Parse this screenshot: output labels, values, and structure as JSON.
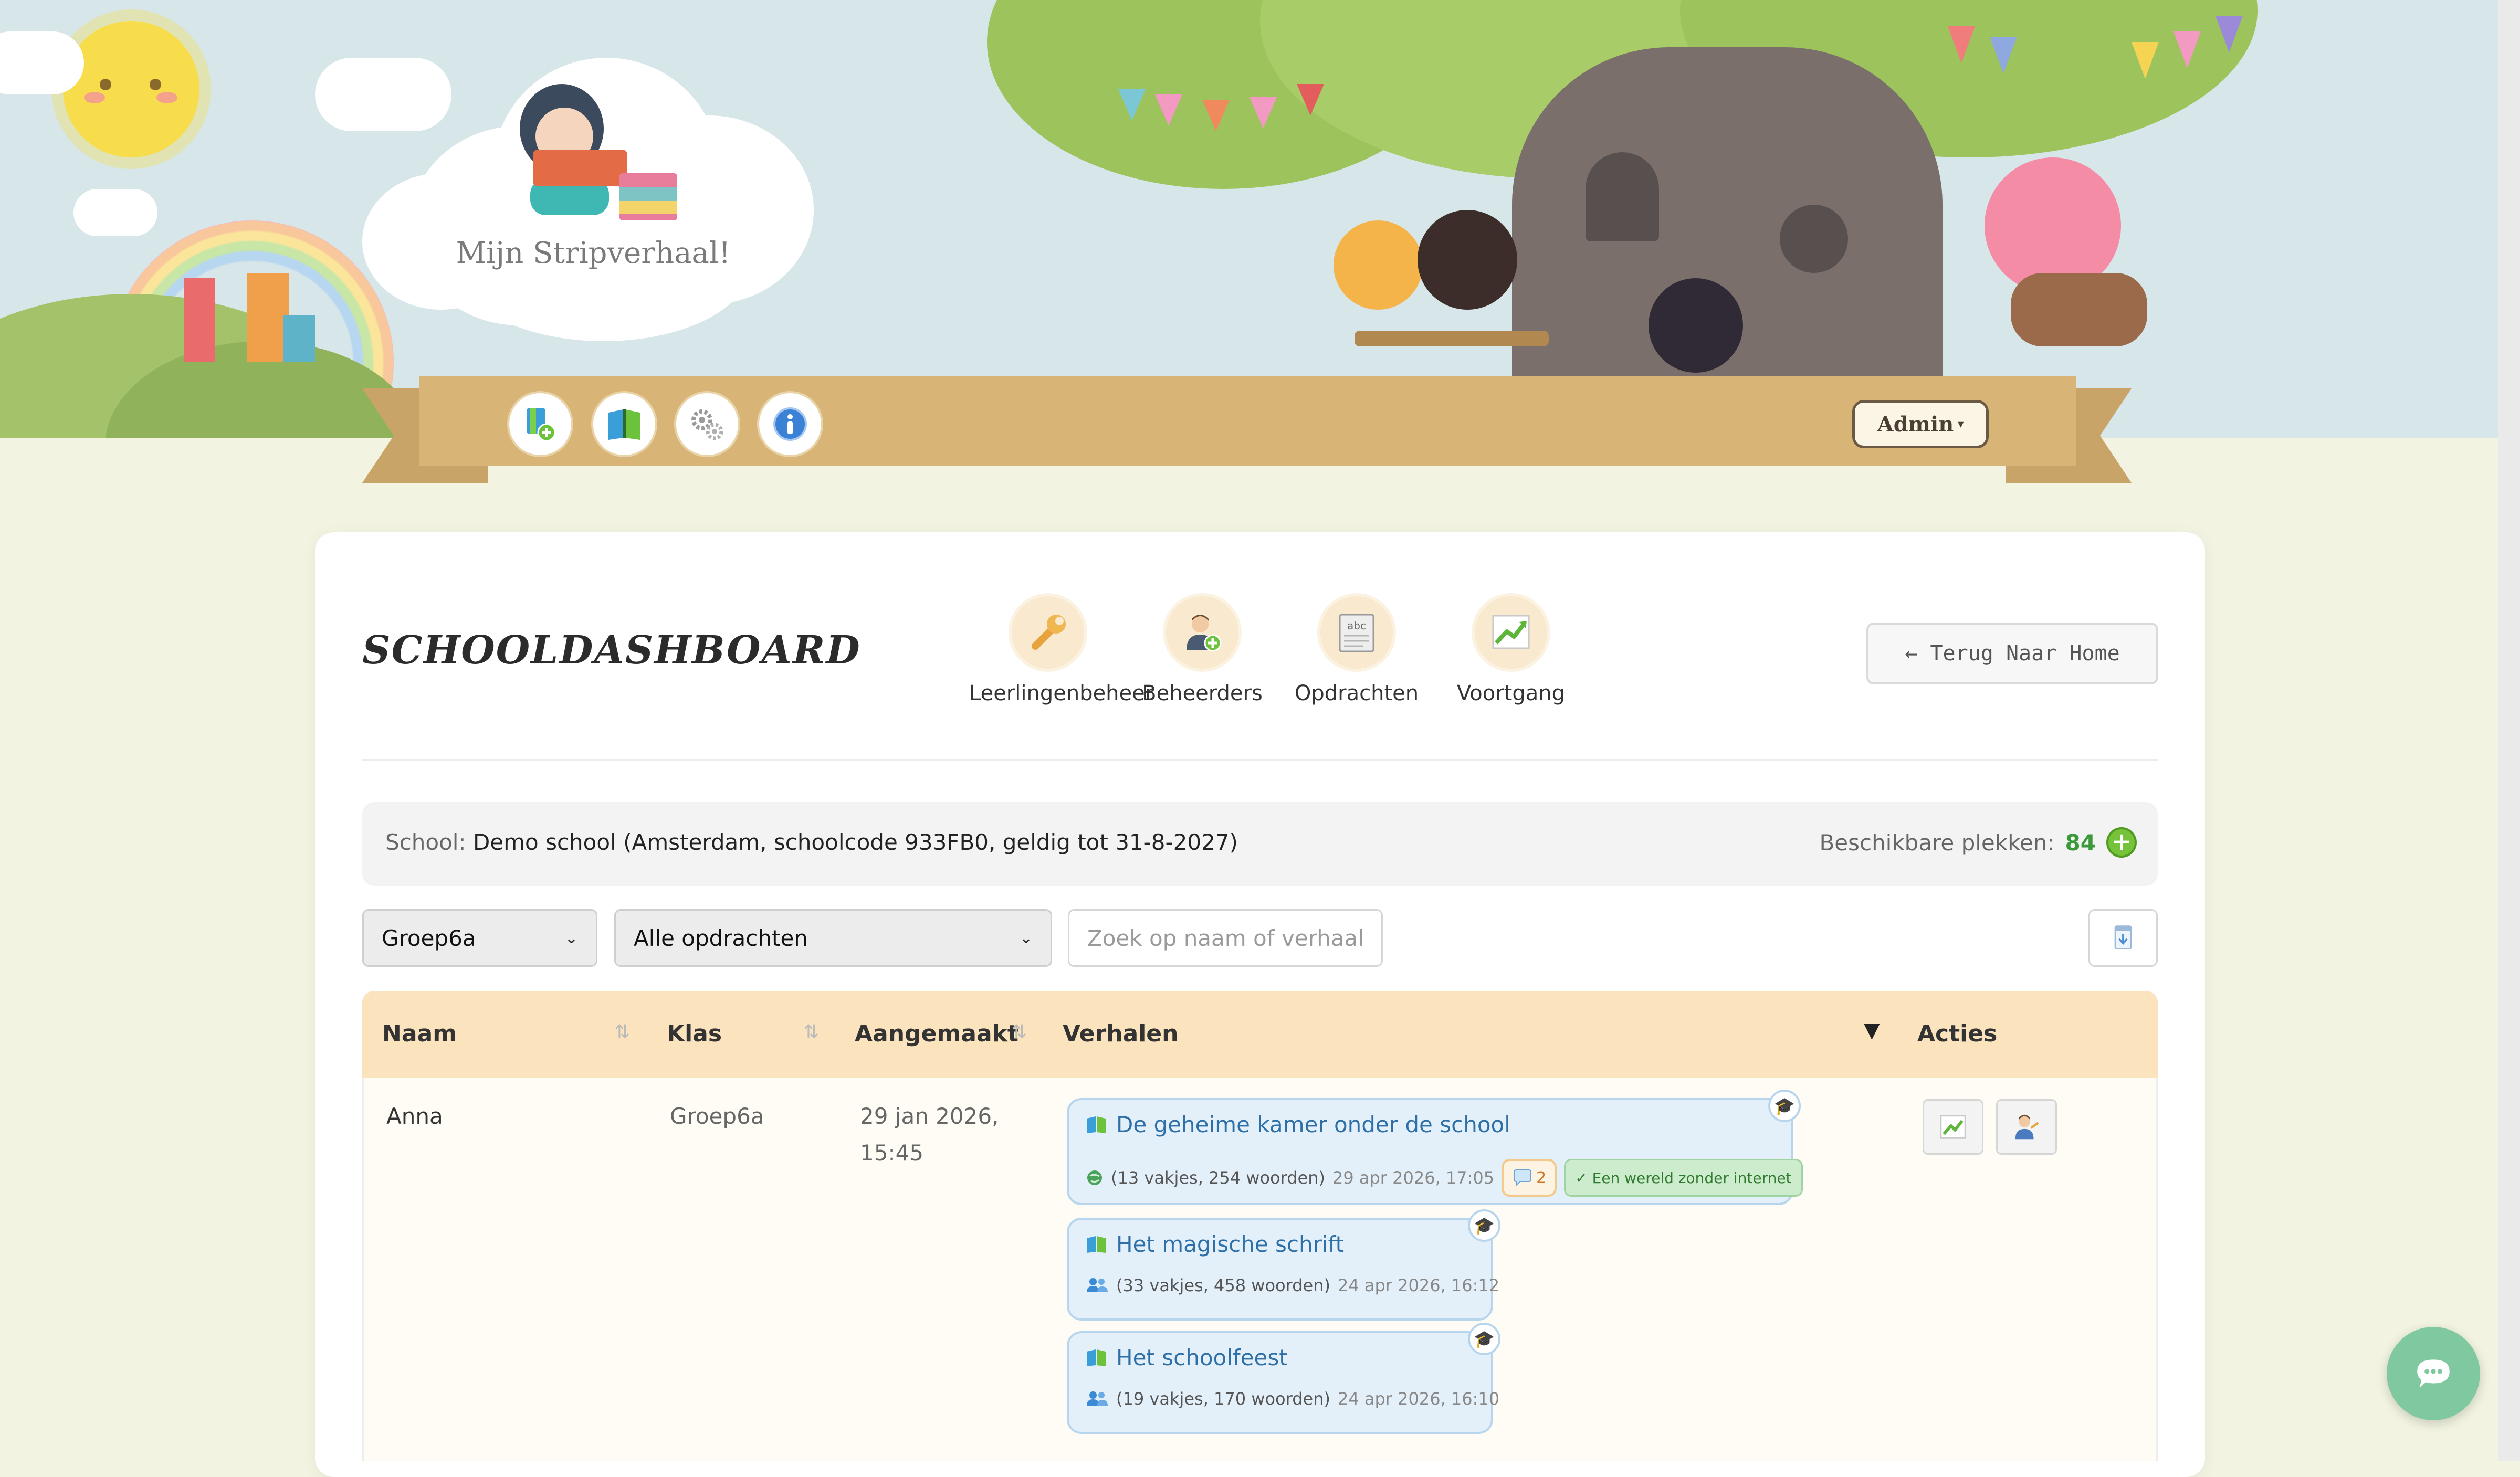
{
  "header": {
    "logo_title": "Mijn Stripverhaal!",
    "nav_icons": [
      "new-story-icon",
      "stories-book-icon",
      "settings-gears-icon",
      "info-icon"
    ],
    "admin_label": "Admin",
    "admin_caret": "▾"
  },
  "dashboard": {
    "title": "SCHOOLDASHBOARD",
    "tools": [
      {
        "label": "Leerlingenbeheer",
        "icon": "wrench-icon"
      },
      {
        "label": "Beheerders",
        "icon": "add-admin-icon"
      },
      {
        "label": "Opdrachten",
        "icon": "assignment-icon"
      },
      {
        "label": "Voortgang",
        "icon": "progress-chart-icon"
      }
    ],
    "back_label": "← Terug Naar Home"
  },
  "school": {
    "prefix": "School: ",
    "info": "Demo school (Amsterdam, schoolcode 933FB0, geldig tot 31-8-2027)",
    "seats_label": "Beschikbare plekken: ",
    "seats_count": "84"
  },
  "filters": {
    "group": "Groep6a",
    "assignment": "Alle opdrachten",
    "search_placeholder": "Zoek op naam of verhaal..."
  },
  "table": {
    "headers": [
      "Naam",
      "Klas",
      "Aangemaakt",
      "Verhalen",
      "Acties"
    ],
    "sort_glyph": "⇅",
    "verhalen_sort": "▼",
    "rows": [
      {
        "naam": "Anna",
        "klas": "Groep6a",
        "aangemaakt_date": "29 jan 2026,",
        "aangemaakt_time": "15:45",
        "stories": [
          {
            "title": "De geheime kamer onder de school",
            "details": "(13 vakjes, 254 woorden)",
            "date": "29 apr 2026, 17:05",
            "comments": "2",
            "assignment": "✓ Een wereld zonder internet"
          },
          {
            "title": "Het magische schrift",
            "details": "(33 vakjes, 458 woorden)",
            "date": "24 apr 2026, 16:12"
          },
          {
            "title": "Het schoolfeest",
            "details": "(19 vakjes, 170 woorden)",
            "date": "24 apr 2026, 16:10"
          }
        ]
      }
    ]
  },
  "colors": {
    "header_bg": "#fae3bd",
    "story_bg": "#e3f0fa",
    "link": "#2e6fa7",
    "seats": "#3a9a3a",
    "chat": "#7fc8a0"
  }
}
